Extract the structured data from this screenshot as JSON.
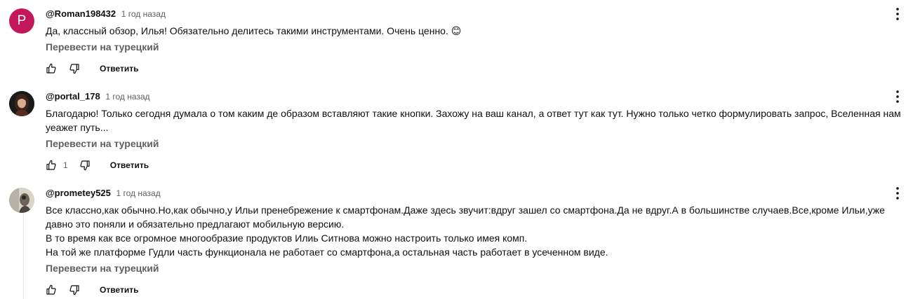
{
  "comments": [
    {
      "avatar_letter": "P",
      "avatar_color": "#c2185b",
      "author": "@Roman198432",
      "time": "1 год назад",
      "text": "Да, классный обзор, Илья! Обязательно делитесь такими инструментами. Очень ценно. 😊",
      "translate": "Перевести на турецкий",
      "likes": "",
      "reply": "Ответить"
    },
    {
      "avatar_letter": "",
      "author": "@portal_178",
      "time": "1 год назад",
      "text": "Благодарю! Только сегодня думала о том каким де образом вставляют такие кнопки. Захожу на ваш канал, а ответ тут как тут. Нужно только четко формулировать запрос, Вселенная нам уеажет путь...",
      "translate": "Перевести на турецкий",
      "likes": "1",
      "reply": "Ответить"
    },
    {
      "avatar_letter": "",
      "author": "@prometey525",
      "time": "1 год назад",
      "text": "Все классно,как обычно.Но,как обычно,у Ильи пренебрежение к смартфонам.Даже здесь звучит:вдруг зашел со смартфона.Да не вдруг.А в большинстве случаев.Все,кроме Ильи,уже давно это поняли и обязательно предлагают мобильную версию.\nВ то время как все огромное многообразие продуктов Илиь Ситнова можно настроить только имея комп.\nНа той же платформе Гудли часть  функционала не работает со смартфона,а остальная часть работает в усеченном виде.",
      "translate": "Перевести на турецкий",
      "likes": "",
      "reply": "Ответить"
    }
  ]
}
